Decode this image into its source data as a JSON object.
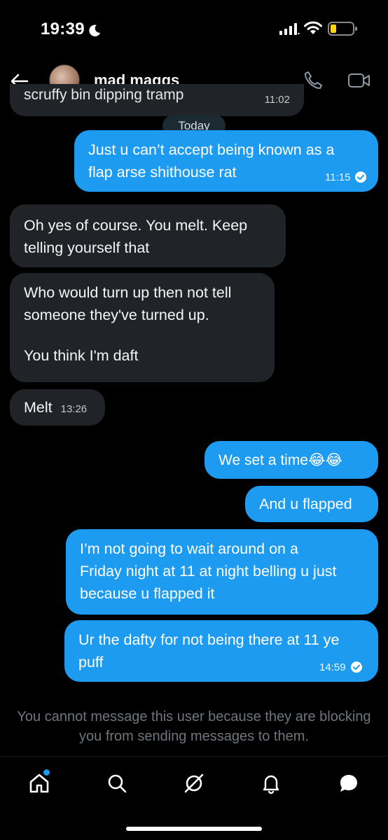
{
  "status_bar": {
    "time": "19:39"
  },
  "header": {
    "contact_name": "mad maggs"
  },
  "colors": {
    "sent_bubble": "#1d9bf0",
    "received_bubble": "#202327",
    "accent": "#1d9bf0"
  },
  "conversation": {
    "cut_off_message": {
      "text": "scruffy bin dipping tramp",
      "time": "11:02"
    },
    "date_separator": "Today",
    "messages": [
      {
        "direction": "sent",
        "lines": [
          "Just u can’t accept being known as a",
          "flap arse shithouse rat"
        ],
        "time": "11:15",
        "read": true
      },
      {
        "direction": "received",
        "lines": [
          "Oh yes of course. You melt. Keep",
          "telling yourself that"
        ]
      },
      {
        "direction": "received",
        "lines": [
          "Who would turn up then not tell",
          "someone they've turned up.",
          "",
          "You think I'm daft"
        ]
      },
      {
        "direction": "received",
        "lines": [
          "Melt"
        ],
        "time": "13:26"
      },
      {
        "direction": "sent",
        "lines": [
          "We set a time😂😂"
        ]
      },
      {
        "direction": "sent",
        "lines": [
          "And u flapped"
        ]
      },
      {
        "direction": "sent",
        "lines": [
          "I’m not going to wait around on a",
          "Friday night at 11 at night belling u just",
          "because u flapped it"
        ]
      },
      {
        "direction": "sent",
        "lines": [
          "Ur the dafty for not being there at 11 ye",
          "puff"
        ],
        "time": "14:59",
        "read": true
      }
    ]
  },
  "blocked_notice": "You cannot message this user because they are blocking you from sending messages to them.",
  "bottom_nav": {
    "items": [
      {
        "icon": "home-icon",
        "active": true,
        "has_dot": true
      },
      {
        "icon": "search-icon"
      },
      {
        "icon": "grok-icon"
      },
      {
        "icon": "bell-icon"
      },
      {
        "icon": "messages-icon",
        "active": true
      }
    ]
  }
}
